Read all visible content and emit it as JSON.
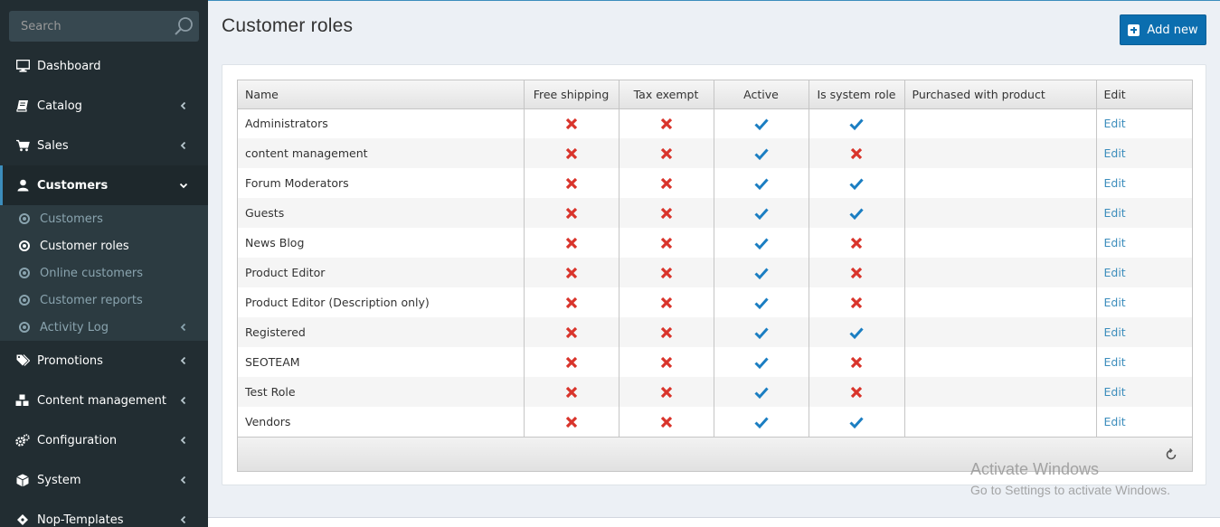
{
  "sidebar": {
    "search_placeholder": "Search",
    "menu": [
      {
        "label": "Dashboard",
        "icon": "monitor-icon"
      },
      {
        "label": "Catalog",
        "icon": "book-icon"
      },
      {
        "label": "Sales",
        "icon": "cart-icon"
      },
      {
        "label": "Customers",
        "icon": "user-icon"
      },
      {
        "label": "Promotions",
        "icon": "tags-icon"
      },
      {
        "label": "Content management",
        "icon": "cubes-icon"
      },
      {
        "label": "Configuration",
        "icon": "gears-icon"
      },
      {
        "label": "System",
        "icon": "cube-icon"
      },
      {
        "label": "Nop-Templates",
        "icon": "puzzle-icon"
      }
    ],
    "customers_submenu": [
      {
        "label": "Customers"
      },
      {
        "label": "Customer roles"
      },
      {
        "label": "Online customers"
      },
      {
        "label": "Customer reports"
      },
      {
        "label": "Activity Log"
      }
    ]
  },
  "page": {
    "title": "Customer roles",
    "add_button": "Add new"
  },
  "grid": {
    "columns": [
      "Name",
      "Free shipping",
      "Tax exempt",
      "Active",
      "Is system role",
      "Purchased with product",
      "Edit"
    ],
    "rows": [
      {
        "name": "Administrators",
        "free_shipping": false,
        "tax_exempt": false,
        "active": true,
        "system": true,
        "purchased": "",
        "edit": "Edit"
      },
      {
        "name": "content management",
        "free_shipping": false,
        "tax_exempt": false,
        "active": true,
        "system": false,
        "purchased": "",
        "edit": "Edit"
      },
      {
        "name": "Forum Moderators",
        "free_shipping": false,
        "tax_exempt": false,
        "active": true,
        "system": true,
        "purchased": "",
        "edit": "Edit"
      },
      {
        "name": "Guests",
        "free_shipping": false,
        "tax_exempt": false,
        "active": true,
        "system": true,
        "purchased": "",
        "edit": "Edit"
      },
      {
        "name": "News Blog",
        "free_shipping": false,
        "tax_exempt": false,
        "active": true,
        "system": false,
        "purchased": "",
        "edit": "Edit"
      },
      {
        "name": "Product Editor",
        "free_shipping": false,
        "tax_exempt": false,
        "active": true,
        "system": false,
        "purchased": "",
        "edit": "Edit"
      },
      {
        "name": "Product Editor (Description only)",
        "free_shipping": false,
        "tax_exempt": false,
        "active": true,
        "system": false,
        "purchased": "",
        "edit": "Edit"
      },
      {
        "name": "Registered",
        "free_shipping": false,
        "tax_exempt": false,
        "active": true,
        "system": true,
        "purchased": "",
        "edit": "Edit"
      },
      {
        "name": "SEOTEAM",
        "free_shipping": false,
        "tax_exempt": false,
        "active": true,
        "system": false,
        "purchased": "",
        "edit": "Edit"
      },
      {
        "name": "Test Role",
        "free_shipping": false,
        "tax_exempt": false,
        "active": true,
        "system": false,
        "purchased": "",
        "edit": "Edit"
      },
      {
        "name": "Vendors",
        "free_shipping": false,
        "tax_exempt": false,
        "active": true,
        "system": true,
        "purchased": "",
        "edit": "Edit"
      }
    ]
  },
  "colors": {
    "check": "#1b7ec2",
    "cross": "#d9342b",
    "link": "#3c8dbc",
    "sidebar_bg": "#222d32",
    "primary_button": "#0b6eaf"
  },
  "watermark": {
    "title": "Activate Windows",
    "subtitle": "Go to Settings to activate Windows."
  }
}
